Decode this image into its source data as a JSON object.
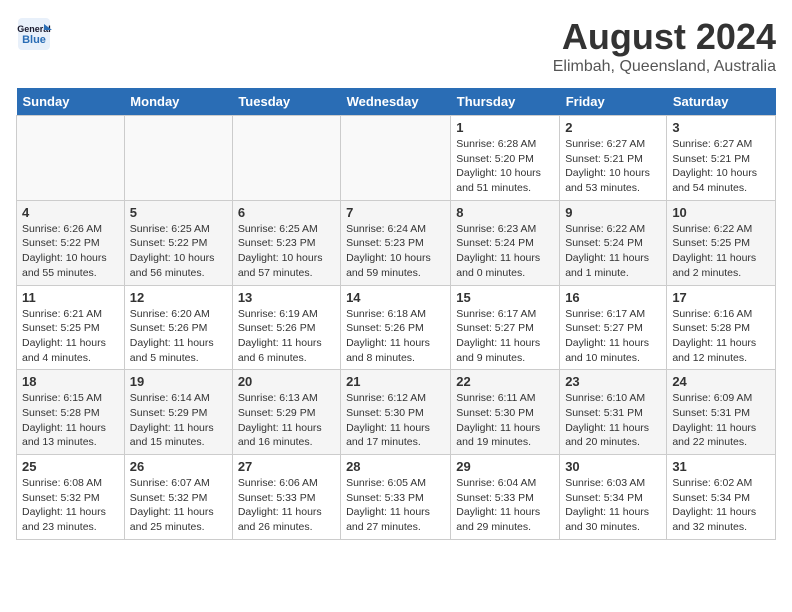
{
  "header": {
    "logo_general": "General",
    "logo_blue": "Blue",
    "title": "August 2024",
    "subtitle": "Elimbah, Queensland, Australia"
  },
  "weekdays": [
    "Sunday",
    "Monday",
    "Tuesday",
    "Wednesday",
    "Thursday",
    "Friday",
    "Saturday"
  ],
  "weeks": [
    [
      {
        "day": "",
        "info": "",
        "empty": true
      },
      {
        "day": "",
        "info": "",
        "empty": true
      },
      {
        "day": "",
        "info": "",
        "empty": true
      },
      {
        "day": "",
        "info": "",
        "empty": true
      },
      {
        "day": "1",
        "info": "Sunrise: 6:28 AM\nSunset: 5:20 PM\nDaylight: 10 hours\nand 51 minutes."
      },
      {
        "day": "2",
        "info": "Sunrise: 6:27 AM\nSunset: 5:21 PM\nDaylight: 10 hours\nand 53 minutes."
      },
      {
        "day": "3",
        "info": "Sunrise: 6:27 AM\nSunset: 5:21 PM\nDaylight: 10 hours\nand 54 minutes."
      }
    ],
    [
      {
        "day": "4",
        "info": "Sunrise: 6:26 AM\nSunset: 5:22 PM\nDaylight: 10 hours\nand 55 minutes."
      },
      {
        "day": "5",
        "info": "Sunrise: 6:25 AM\nSunset: 5:22 PM\nDaylight: 10 hours\nand 56 minutes."
      },
      {
        "day": "6",
        "info": "Sunrise: 6:25 AM\nSunset: 5:23 PM\nDaylight: 10 hours\nand 57 minutes."
      },
      {
        "day": "7",
        "info": "Sunrise: 6:24 AM\nSunset: 5:23 PM\nDaylight: 10 hours\nand 59 minutes."
      },
      {
        "day": "8",
        "info": "Sunrise: 6:23 AM\nSunset: 5:24 PM\nDaylight: 11 hours\nand 0 minutes."
      },
      {
        "day": "9",
        "info": "Sunrise: 6:22 AM\nSunset: 5:24 PM\nDaylight: 11 hours\nand 1 minute."
      },
      {
        "day": "10",
        "info": "Sunrise: 6:22 AM\nSunset: 5:25 PM\nDaylight: 11 hours\nand 2 minutes."
      }
    ],
    [
      {
        "day": "11",
        "info": "Sunrise: 6:21 AM\nSunset: 5:25 PM\nDaylight: 11 hours\nand 4 minutes."
      },
      {
        "day": "12",
        "info": "Sunrise: 6:20 AM\nSunset: 5:26 PM\nDaylight: 11 hours\nand 5 minutes."
      },
      {
        "day": "13",
        "info": "Sunrise: 6:19 AM\nSunset: 5:26 PM\nDaylight: 11 hours\nand 6 minutes."
      },
      {
        "day": "14",
        "info": "Sunrise: 6:18 AM\nSunset: 5:26 PM\nDaylight: 11 hours\nand 8 minutes."
      },
      {
        "day": "15",
        "info": "Sunrise: 6:17 AM\nSunset: 5:27 PM\nDaylight: 11 hours\nand 9 minutes."
      },
      {
        "day": "16",
        "info": "Sunrise: 6:17 AM\nSunset: 5:27 PM\nDaylight: 11 hours\nand 10 minutes."
      },
      {
        "day": "17",
        "info": "Sunrise: 6:16 AM\nSunset: 5:28 PM\nDaylight: 11 hours\nand 12 minutes."
      }
    ],
    [
      {
        "day": "18",
        "info": "Sunrise: 6:15 AM\nSunset: 5:28 PM\nDaylight: 11 hours\nand 13 minutes."
      },
      {
        "day": "19",
        "info": "Sunrise: 6:14 AM\nSunset: 5:29 PM\nDaylight: 11 hours\nand 15 minutes."
      },
      {
        "day": "20",
        "info": "Sunrise: 6:13 AM\nSunset: 5:29 PM\nDaylight: 11 hours\nand 16 minutes."
      },
      {
        "day": "21",
        "info": "Sunrise: 6:12 AM\nSunset: 5:30 PM\nDaylight: 11 hours\nand 17 minutes."
      },
      {
        "day": "22",
        "info": "Sunrise: 6:11 AM\nSunset: 5:30 PM\nDaylight: 11 hours\nand 19 minutes."
      },
      {
        "day": "23",
        "info": "Sunrise: 6:10 AM\nSunset: 5:31 PM\nDaylight: 11 hours\nand 20 minutes."
      },
      {
        "day": "24",
        "info": "Sunrise: 6:09 AM\nSunset: 5:31 PM\nDaylight: 11 hours\nand 22 minutes."
      }
    ],
    [
      {
        "day": "25",
        "info": "Sunrise: 6:08 AM\nSunset: 5:32 PM\nDaylight: 11 hours\nand 23 minutes."
      },
      {
        "day": "26",
        "info": "Sunrise: 6:07 AM\nSunset: 5:32 PM\nDaylight: 11 hours\nand 25 minutes."
      },
      {
        "day": "27",
        "info": "Sunrise: 6:06 AM\nSunset: 5:33 PM\nDaylight: 11 hours\nand 26 minutes."
      },
      {
        "day": "28",
        "info": "Sunrise: 6:05 AM\nSunset: 5:33 PM\nDaylight: 11 hours\nand 27 minutes."
      },
      {
        "day": "29",
        "info": "Sunrise: 6:04 AM\nSunset: 5:33 PM\nDaylight: 11 hours\nand 29 minutes."
      },
      {
        "day": "30",
        "info": "Sunrise: 6:03 AM\nSunset: 5:34 PM\nDaylight: 11 hours\nand 30 minutes."
      },
      {
        "day": "31",
        "info": "Sunrise: 6:02 AM\nSunset: 5:34 PM\nDaylight: 11 hours\nand 32 minutes."
      }
    ]
  ]
}
